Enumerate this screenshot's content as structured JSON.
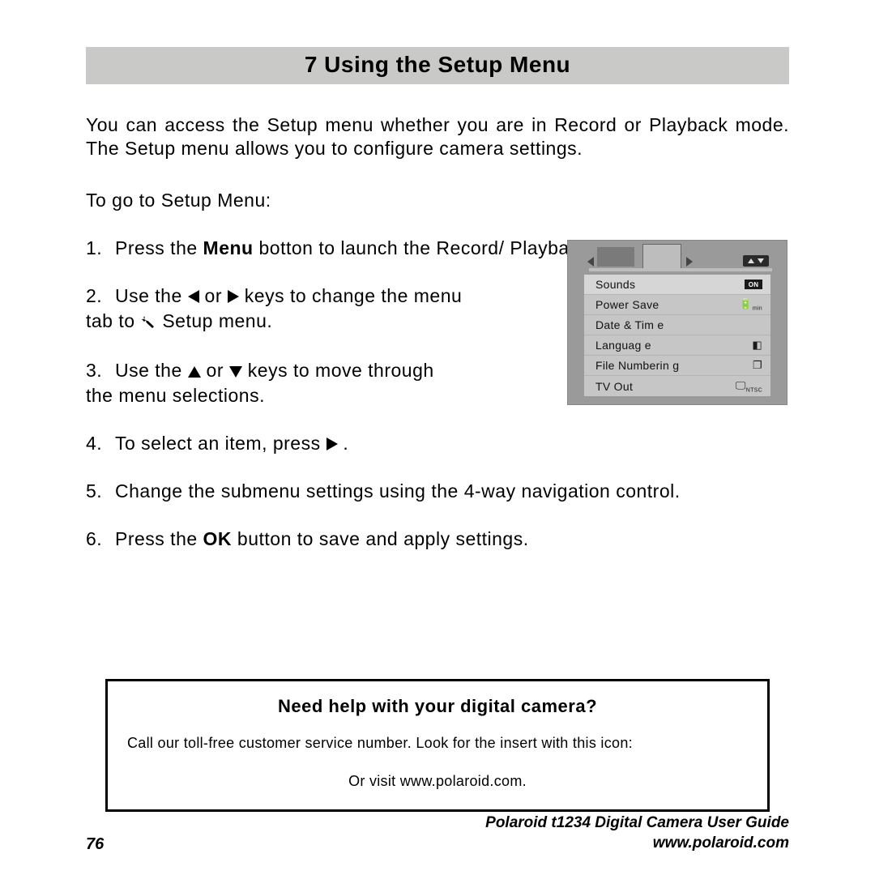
{
  "section_title": "7 Using the Setup Menu",
  "intro": "You can access the Setup menu whether you are in Record or Playback mode. The Setup menu allows you to configure camera settings.",
  "lead": "To go to Setup Menu:",
  "steps": {
    "s1_a": "Press the ",
    "s1_b": "Menu",
    "s1_c": " botton to launch the Record/ Playback Menu.",
    "s2_a": "Use the ",
    "s2_b": " or ",
    "s2_c": " keys to change the menu tab to ",
    "s2_d": " Setup menu.",
    "s3_a": "Use the ",
    "s3_b": " or ",
    "s3_c": " keys to move through the menu selections.",
    "s4_a": "To select an item, press ",
    "s4_b": " .",
    "s5": "Change the submenu settings using the 4-way navigation control.",
    "s6_a": "Press the ",
    "s6_b": "OK",
    "s6_c": " button to save and apply settings."
  },
  "camera_menu": {
    "rows": [
      {
        "label": "Sounds",
        "value": "ON"
      },
      {
        "label": "Power Save",
        "value": "3min"
      },
      {
        "label": "Date & Tim e",
        "value": ""
      },
      {
        "label": "Languag e",
        "value": "lang"
      },
      {
        "label": "File Numberin g",
        "value": "copy"
      },
      {
        "label": "TV Out",
        "value": "NTSC"
      }
    ]
  },
  "help": {
    "title": "Need help with your digital camera?",
    "line": "Call our toll-free customer service number. Look for the insert with this icon:",
    "visit": "Or visit www.polaroid.com."
  },
  "footer": {
    "page": "76",
    "guide": "Polaroid t1234 Digital Camera User Guide",
    "url": "www.polaroid.com"
  }
}
